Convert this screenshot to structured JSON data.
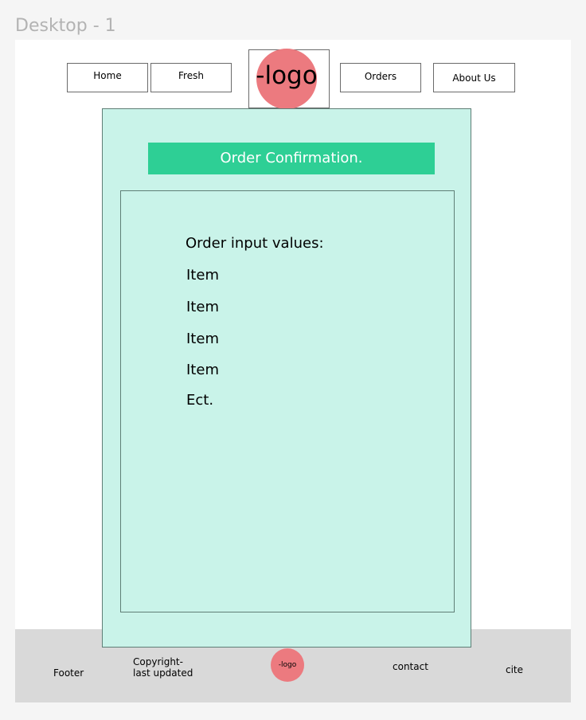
{
  "frame": {
    "label": "Desktop - 1"
  },
  "nav": {
    "home": "Home",
    "fresh": "Fresh",
    "orders": "Orders",
    "about": "About Us"
  },
  "logo": {
    "text": "-logo"
  },
  "main": {
    "banner": "Order Confirmation.",
    "heading": "Order input values:",
    "items": [
      "Item",
      "Item",
      "Item",
      "Item",
      "Ect."
    ]
  },
  "footer": {
    "label": "Footer",
    "copyright_line1": "Copyright-",
    "copyright_line2": "last updated",
    "logo_text": "-logo",
    "contact": "contact",
    "cite": "cite"
  },
  "colors": {
    "logo": "#ec7a7f",
    "banner": "#2ecf95",
    "card": "#c9f3e9",
    "footer": "#d9d9d9"
  }
}
